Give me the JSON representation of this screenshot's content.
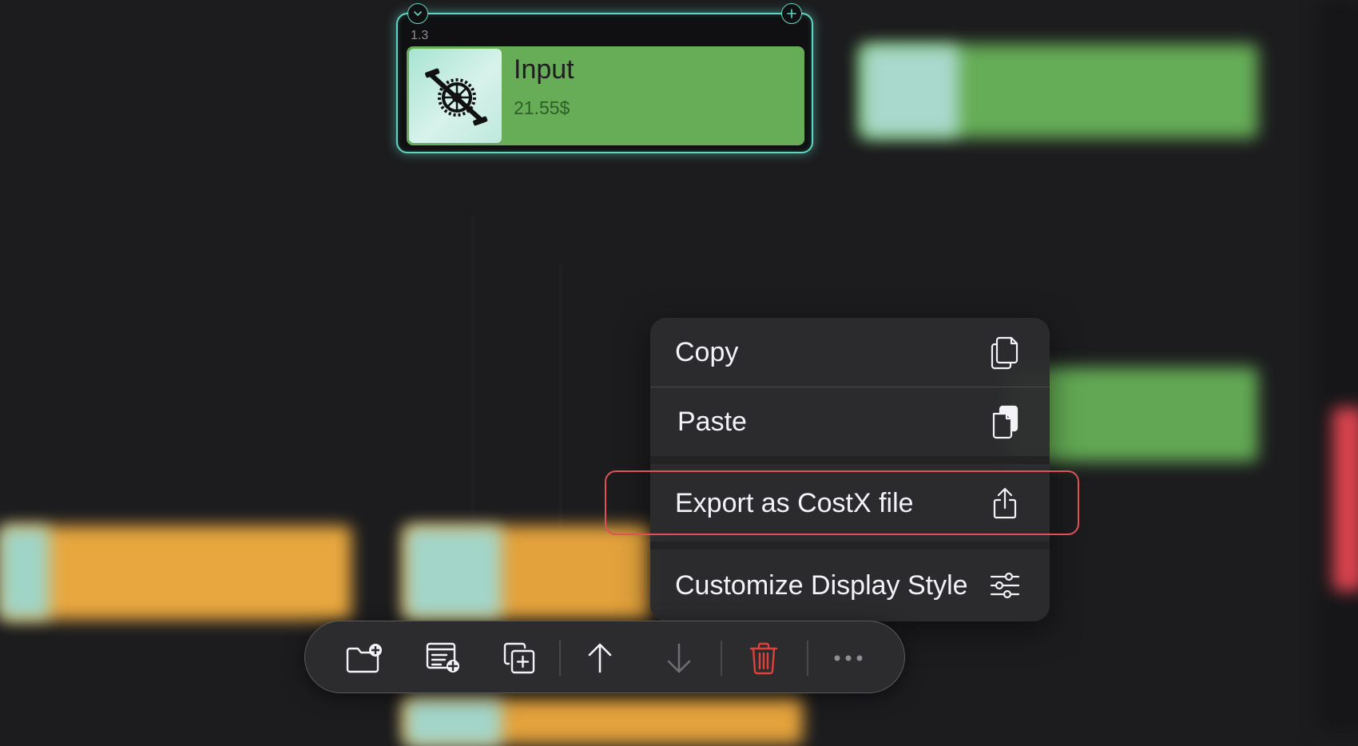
{
  "node": {
    "id_label": "1.3",
    "title": "Input",
    "price": "21.55$",
    "thumbnail_icon": "bicycle-crankset-icon",
    "card_color": "#67ad58",
    "border_color": "#5fd6c0"
  },
  "context_menu": {
    "items": [
      {
        "label": "Copy",
        "icon": "copy-icon"
      },
      {
        "label": "Paste",
        "icon": "paste-icon"
      },
      {
        "label": "Export as CostX file",
        "icon": "share-icon",
        "highlighted": true
      },
      {
        "label": "Customize Display Style",
        "icon": "sliders-icon"
      }
    ],
    "highlight_color": "#e0505a"
  },
  "toolbar": {
    "buttons": [
      {
        "icon": "new-folder-icon",
        "enabled": true
      },
      {
        "icon": "add-item-icon",
        "enabled": true
      },
      {
        "icon": "duplicate-icon",
        "enabled": true
      },
      {
        "icon": "move-up-icon",
        "enabled": true
      },
      {
        "icon": "move-down-icon",
        "enabled": false
      },
      {
        "icon": "trash-icon",
        "enabled": true,
        "color": "#e0403a"
      },
      {
        "icon": "more-icon",
        "enabled": true
      }
    ]
  },
  "colors": {
    "background": "#1c1c1e",
    "green_card": "#67ad58",
    "orange_card": "#e8a73f"
  }
}
